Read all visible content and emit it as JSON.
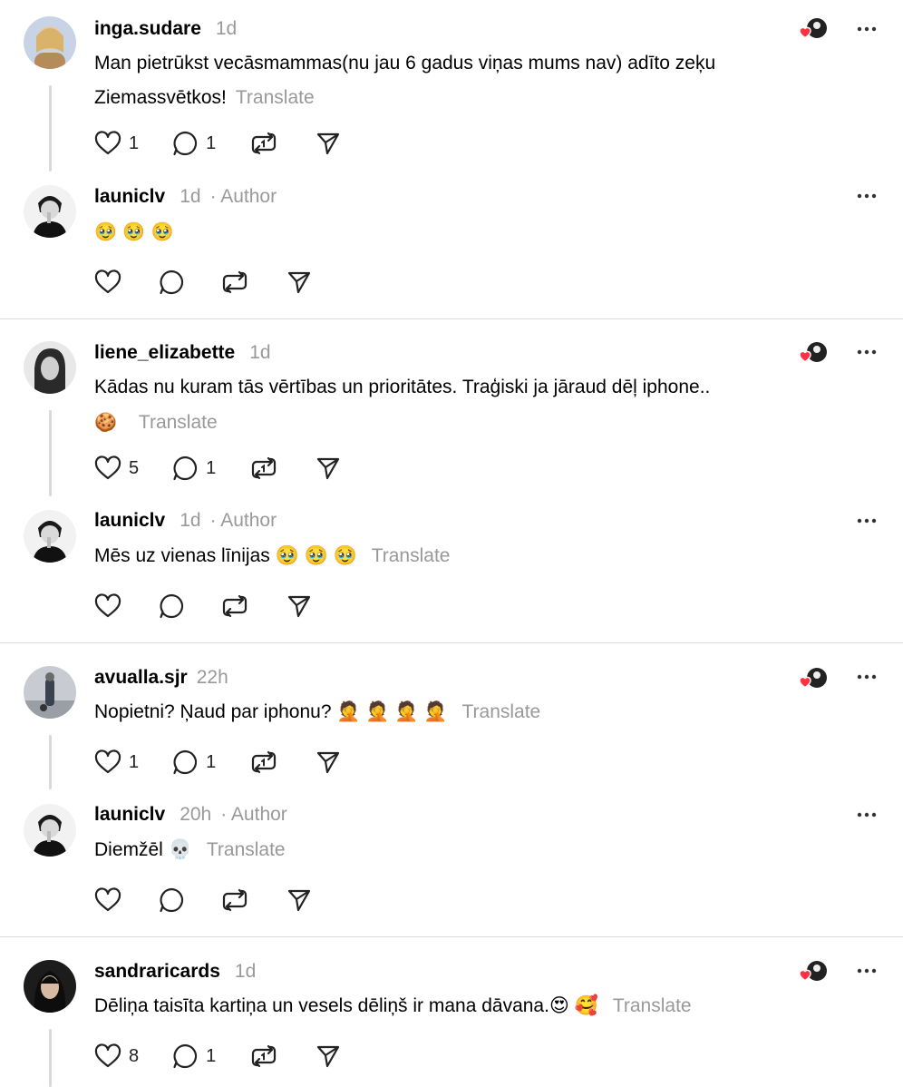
{
  "threads": [
    {
      "post": {
        "username": "inga.sudare",
        "time": "1d",
        "text_lines": [
          "Man pietrūkst vecāsmammas(nu jau 6 gadus viņas mums nav) adīto zeķu",
          "Ziemassvētkos!"
        ],
        "translate": "Translate",
        "likes": "1",
        "replies": "1"
      },
      "reply": {
        "username": "launiclv",
        "time": "1d",
        "author": "· Author",
        "text": "🥹 🥹 🥹",
        "translate": ""
      }
    },
    {
      "post": {
        "username": "liene_elizabette",
        "time": "1d",
        "text_lines": [
          "Kādas nu kuram tās vērtības un prioritātes. Traģiski ja jāraud dēļ iphone..",
          "🍪"
        ],
        "translate": "Translate",
        "likes": "5",
        "replies": "1"
      },
      "reply": {
        "username": "launiclv",
        "time": "1d",
        "author": "· Author",
        "text": "Mēs uz vienas līnijas 🥹 🥹 🥹",
        "translate": "Translate"
      }
    },
    {
      "post": {
        "username": "avualla.sjr",
        "time": "22h",
        "text_lines": [
          "Nopietni? Ņaud par iphonu? 🤦 🤦 🤦 🤦"
        ],
        "translate": "Translate",
        "likes": "1",
        "replies": "1"
      },
      "reply": {
        "username": "launiclv",
        "time": "20h",
        "author": "· Author",
        "text": "Diemžēl 💀",
        "translate": "Translate"
      }
    },
    {
      "post": {
        "username": "sandraricards",
        "time": "1d",
        "text_lines": [
          "Dēliņa taisīta kartiņa un vesels dēliņš ir mana dāvana.😍 🥰"
        ],
        "translate": "Translate",
        "likes": "8",
        "replies": "1"
      }
    }
  ],
  "icons": {
    "like": "heart-icon",
    "reply": "comment-icon",
    "repost": "repost-icon",
    "share": "send-icon",
    "more": "more-icon",
    "liked_by_author": "author-liked-heart-icon"
  },
  "colors": {
    "muted": "#999999",
    "heart": "#ff3040",
    "divider": "#dcdcdc"
  }
}
